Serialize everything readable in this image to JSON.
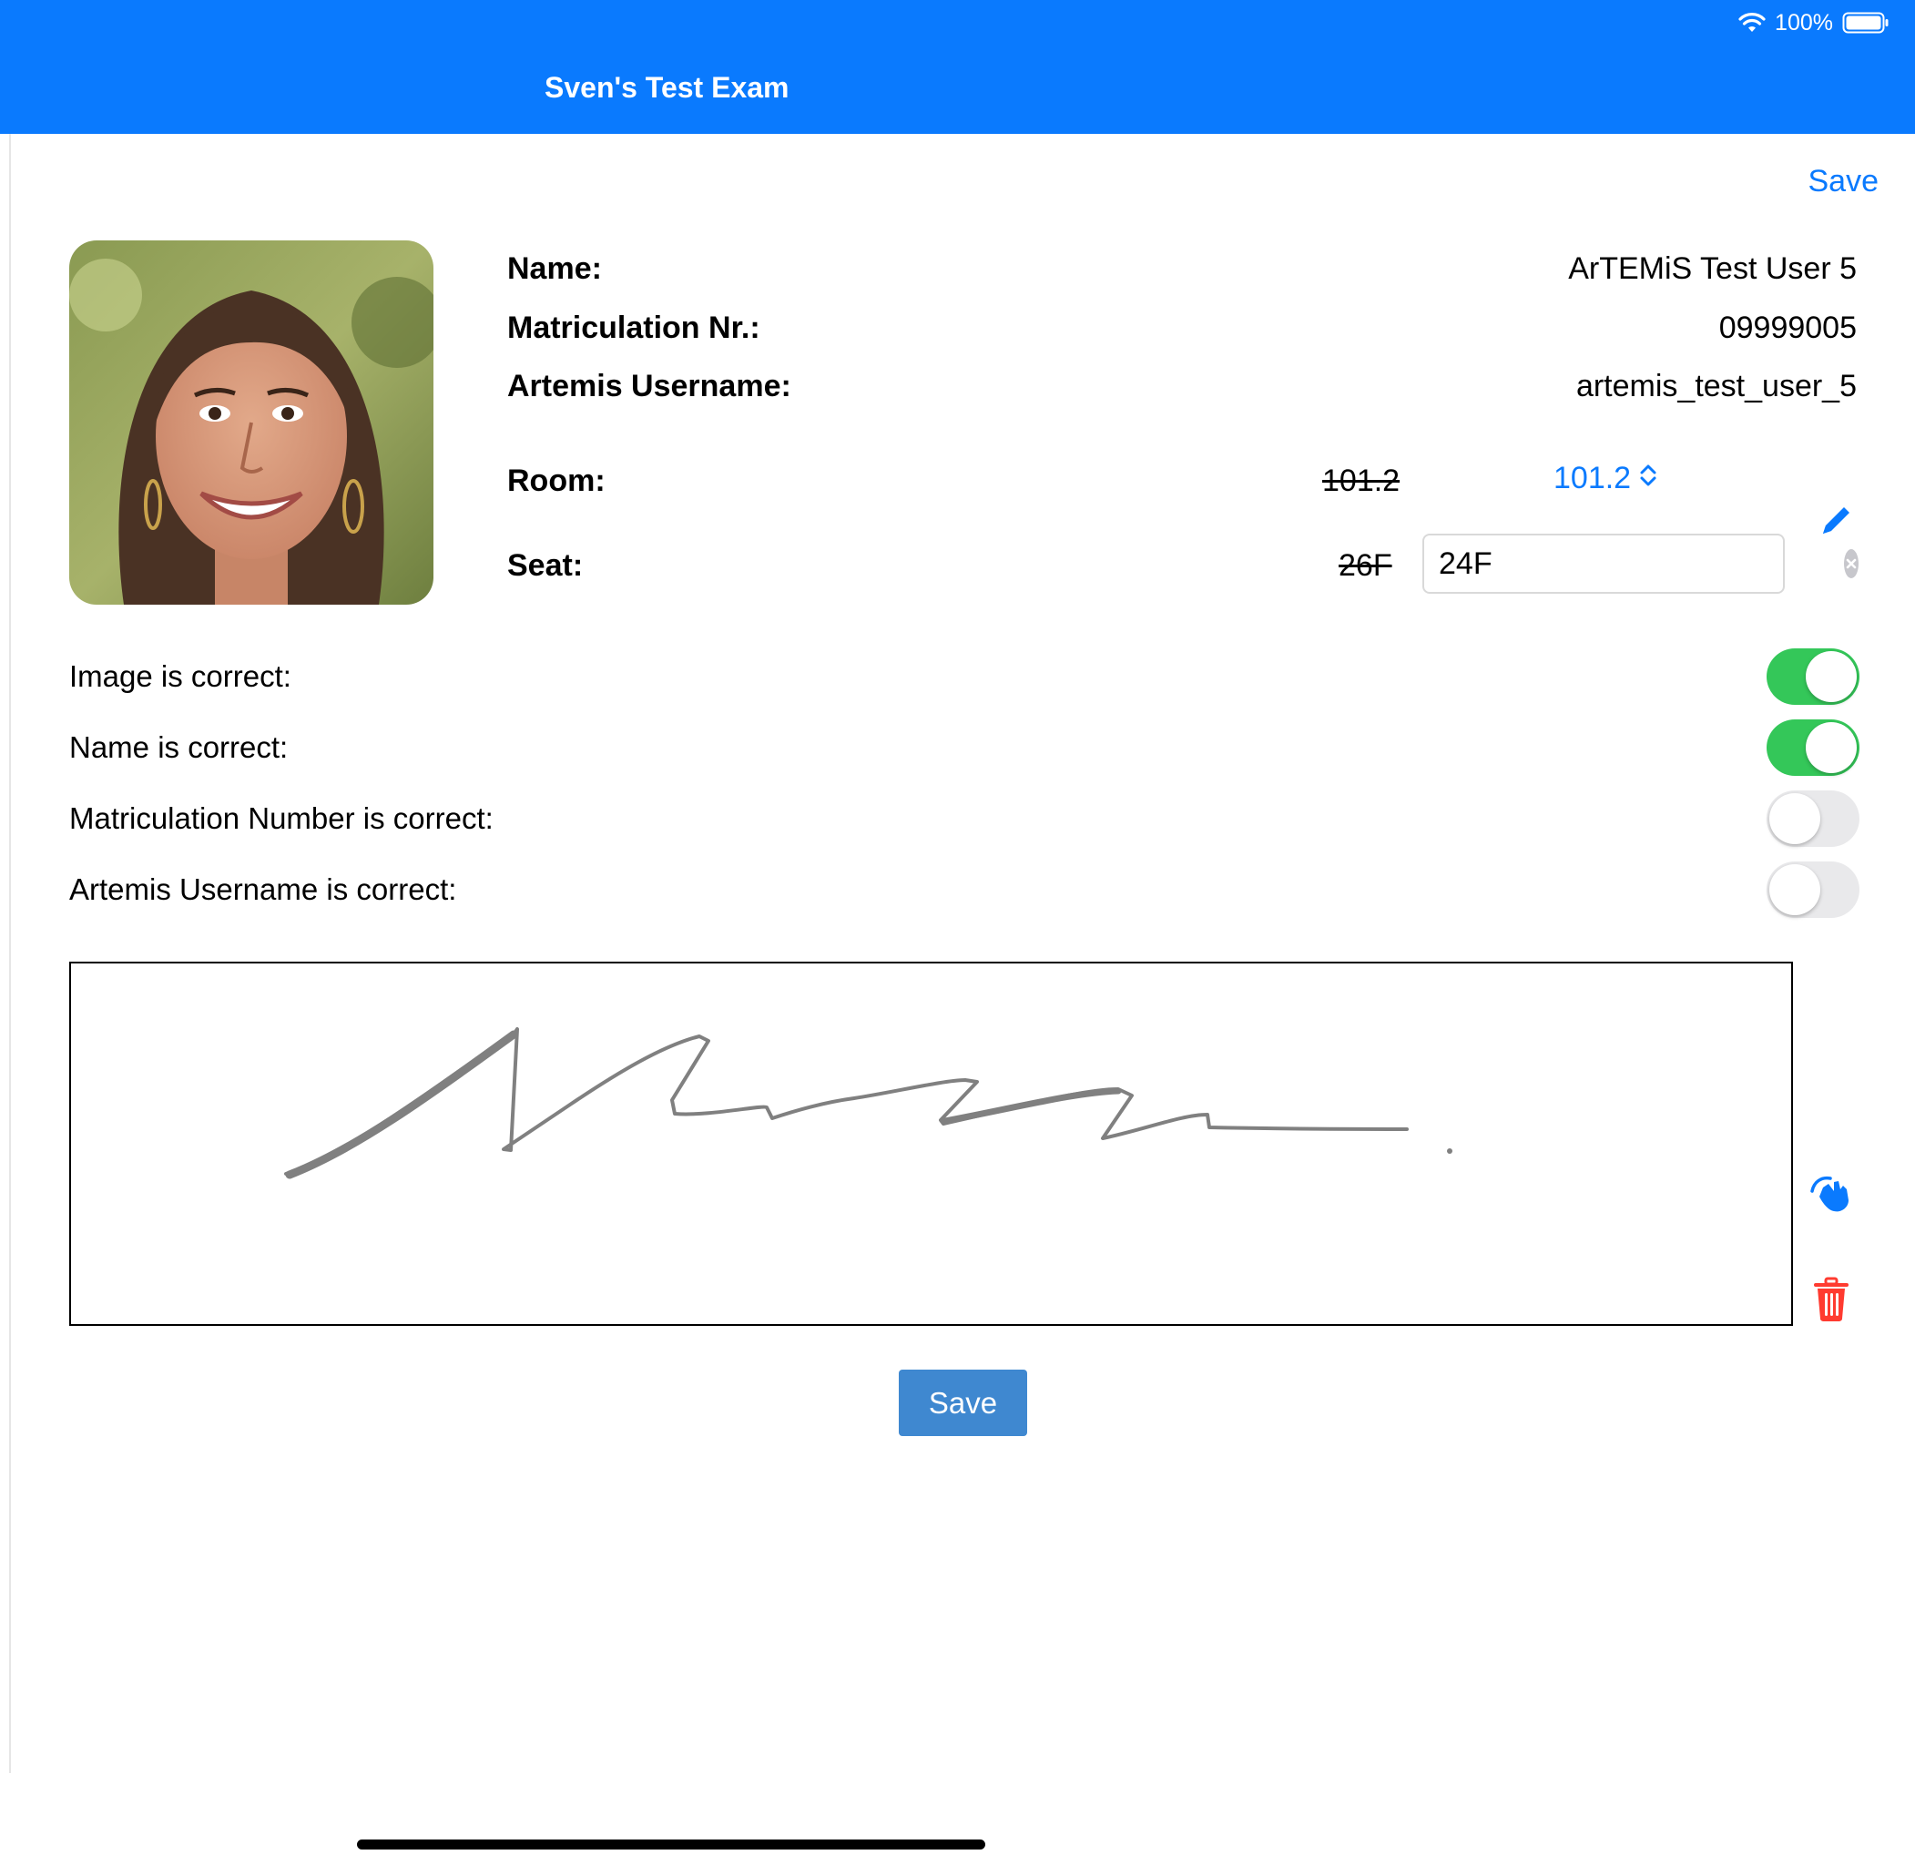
{
  "status_bar": {
    "battery_percent": "100%"
  },
  "nav": {
    "title": "Sven's Test Exam",
    "save_link": "Save"
  },
  "student": {
    "name_label": "Name:",
    "name_value": "ArTEMiS Test User 5",
    "matriculation_label": "Matriculation Nr.:",
    "matriculation_value": "09999005",
    "username_label": "Artemis Username:",
    "username_value": "artemis_test_user_5"
  },
  "room": {
    "label": "Room:",
    "old_value": "101.2",
    "selected_value": "101.2"
  },
  "seat": {
    "label": "Seat:",
    "old_value": "26F",
    "input_value": "24F"
  },
  "checks": [
    {
      "label": "Image is correct:",
      "on": true
    },
    {
      "label": "Name is correct:",
      "on": true
    },
    {
      "label": "Matriculation Number is correct:",
      "on": false
    },
    {
      "label": "Artemis Username is correct:",
      "on": false
    }
  ],
  "signature": {
    "stroke_color": "#808080"
  },
  "actions": {
    "save_button": "Save"
  },
  "colors": {
    "accent": "#0a7afe",
    "toggle_on": "#34c759",
    "delete": "#ff3b30",
    "button": "#3f88d0"
  },
  "icons": [
    "wifi-icon",
    "battery-icon",
    "pencil-icon",
    "clear-icon",
    "chevron-updown-icon",
    "hand-draw-icon",
    "trash-icon"
  ]
}
